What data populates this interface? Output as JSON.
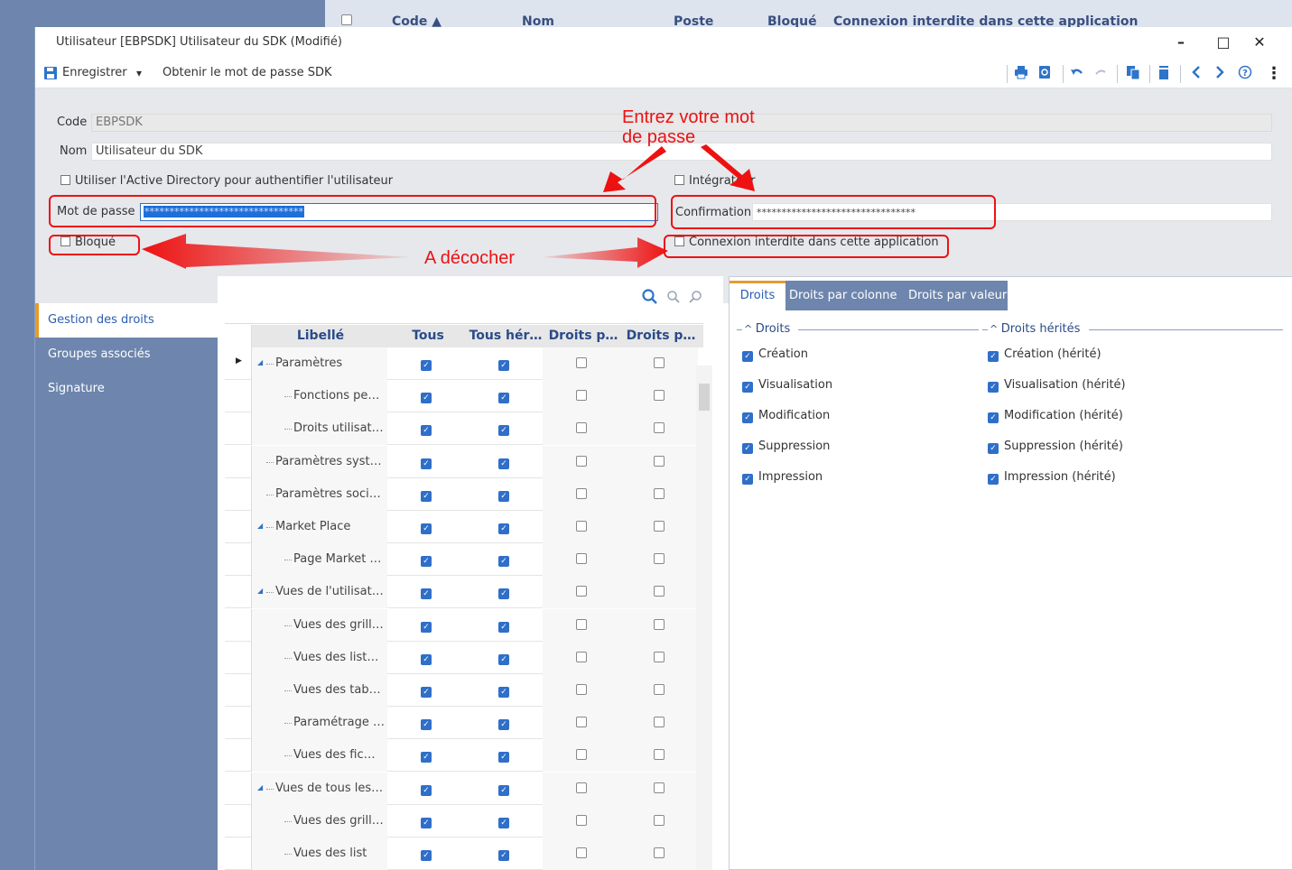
{
  "background": {
    "list_headers": [
      "Code ▲",
      "Nom",
      "Poste",
      "Bloqué",
      "Connexion interdite dans cette application"
    ]
  },
  "window": {
    "title": "Utilisateur [EBPSDK] Utilisateur du SDK (Modifié)",
    "minimize": "–",
    "maximize": "□",
    "close": "✕"
  },
  "toolbar": {
    "save_label": "Enregistrer",
    "save_dropdown": "▾",
    "get_password_label": "Obtenir le mot de passe SDK",
    "more": "⋮"
  },
  "form": {
    "code_label": "Code",
    "code_value": "EBPSDK",
    "nom_label": "Nom",
    "nom_value": "Utilisateur du SDK",
    "ad_label": "Utiliser l'Active Directory pour authentifier l'utilisateur",
    "integrateur_label": "Intégrateur",
    "password_label": "Mot de passe",
    "password_value": "********************************",
    "confirmation_label": "Confirmation",
    "confirmation_value": "********************************",
    "bloque_label": "Bloqué",
    "connexion_label": "Connexion interdite dans cette application"
  },
  "annotations": {
    "password_hint_line1": "Entrez votre mot",
    "password_hint_line2": "de passe",
    "uncheck_hint": "A décocher"
  },
  "sidebar": {
    "items": [
      {
        "label": "Gestion des droits",
        "active": true
      },
      {
        "label": "Groupes associés",
        "active": false
      },
      {
        "label": "Signature",
        "active": false
      }
    ]
  },
  "grid": {
    "columns": [
      "Libellé",
      "Tous",
      "Tous hér…",
      "Droits p…",
      "Droits p…"
    ],
    "rows": [
      {
        "label": "Paramètres",
        "checks": [
          true,
          true,
          false,
          false
        ]
      },
      {
        "label": "Fonctions pe…",
        "checks": [
          true,
          true,
          false,
          false
        ]
      },
      {
        "label": "Droits utilisat…",
        "checks": [
          true,
          true,
          false,
          false
        ]
      },
      {
        "label": "Paramètres syst…",
        "checks": [
          true,
          true,
          false,
          false
        ]
      },
      {
        "label": "Paramètres soci…",
        "checks": [
          true,
          true,
          false,
          false
        ]
      },
      {
        "label": "Market Place",
        "checks": [
          true,
          true,
          false,
          false
        ]
      },
      {
        "label": "Page Market …",
        "checks": [
          true,
          true,
          false,
          false
        ]
      },
      {
        "label": "Vues de l'utilisat…",
        "checks": [
          true,
          true,
          false,
          false
        ]
      },
      {
        "label": "Vues des grill…",
        "checks": [
          true,
          true,
          false,
          false
        ]
      },
      {
        "label": "Vues des list…",
        "checks": [
          true,
          true,
          false,
          false
        ]
      },
      {
        "label": "Vues des tab…",
        "checks": [
          true,
          true,
          false,
          false
        ]
      },
      {
        "label": "Paramétrage …",
        "checks": [
          true,
          true,
          false,
          false
        ]
      },
      {
        "label": "Vues des fic…",
        "checks": [
          true,
          true,
          false,
          false
        ]
      },
      {
        "label": "Vues de tous les…",
        "checks": [
          true,
          true,
          false,
          false
        ]
      },
      {
        "label": "Vues des grill…",
        "checks": [
          true,
          true,
          false,
          false
        ]
      },
      {
        "label": "Vues des list",
        "checks": [
          true,
          true,
          false,
          false
        ]
      }
    ]
  },
  "rights_panel": {
    "tabs": [
      "Droits",
      "Droits par colonne",
      "Droits par valeur"
    ],
    "group_droits": "Droits",
    "group_herites": "Droits hérités",
    "droits": [
      "Création",
      "Visualisation",
      "Modification",
      "Suppression",
      "Impression"
    ],
    "herites": [
      "Création (hérité)",
      "Visualisation (hérité)",
      "Modification (hérité)",
      "Suppression (hérité)",
      "Impression (hérité)"
    ]
  },
  "colors": {
    "accent": "#2f6fc9",
    "sidebar": "#6e86ad",
    "annotation": "#ee1111"
  }
}
